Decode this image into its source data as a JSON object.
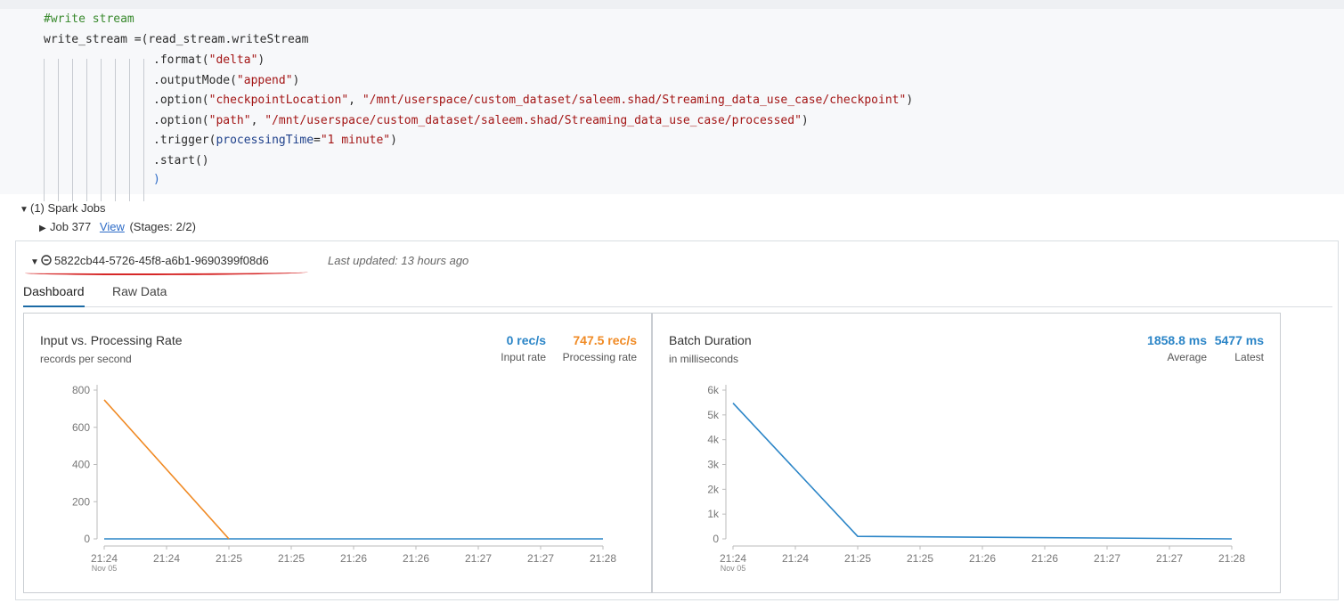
{
  "code": {
    "comment": "#write stream",
    "line1_var": "write_stream",
    "line1_op": " =",
    "line1_rest": "(read_stream.writeStream",
    "lines": [
      {
        "method": ".format(",
        "args": [
          {
            "t": "str",
            "v": "\"delta\""
          }
        ],
        "close": ")"
      },
      {
        "method": ".outputMode(",
        "args": [
          {
            "t": "str",
            "v": "\"append\""
          }
        ],
        "close": ")"
      },
      {
        "method": ".option(",
        "args": [
          {
            "t": "str",
            "v": "\"checkpointLocation\""
          },
          {
            "t": "plain",
            "v": ", "
          },
          {
            "t": "str",
            "v": "\"/mnt/userspace/custom_dataset/saleem.shad/Streaming_data_use_case/checkpoint\""
          }
        ],
        "close": ")"
      },
      {
        "method": ".option(",
        "args": [
          {
            "t": "str",
            "v": "\"path\""
          },
          {
            "t": "plain",
            "v": ", "
          },
          {
            "t": "str",
            "v": "\"/mnt/userspace/custom_dataset/saleem.shad/Streaming_data_use_case/processed\""
          }
        ],
        "close": ")"
      },
      {
        "method": ".trigger(",
        "args": [
          {
            "t": "kw",
            "v": "processingTime"
          },
          {
            "t": "plain",
            "v": "="
          },
          {
            "t": "str",
            "v": "\"1 minute\""
          }
        ],
        "close": ")"
      },
      {
        "method": ".start()",
        "args": [],
        "close": ""
      }
    ],
    "closing_paren": ")"
  },
  "jobs": {
    "summary": "(1) Spark Jobs",
    "job_label": "Job 377",
    "view_link": "View",
    "stages": "(Stages: 2/2)"
  },
  "stream": {
    "id": "5822cb44-5726-45f8-a6b1-9690399f08d6",
    "updated": "Last updated: 13 hours ago",
    "tabs": [
      "Dashboard",
      "Raw Data"
    ]
  },
  "colors": {
    "blue": "#2b85c7",
    "orange": "#f08a24",
    "active_tab": "#1b6aa5",
    "red_underline": "#d62828"
  },
  "rate_card": {
    "title": "Input vs. Processing Rate",
    "subtitle": "records per second",
    "input_value": "0 rec/s",
    "input_label": "Input rate",
    "processing_value": "747.5 rec/s",
    "processing_label": "Processing rate"
  },
  "batch_card": {
    "title": "Batch Duration",
    "subtitle": "in milliseconds",
    "average_value": "1858.8 ms",
    "average_label": "Average",
    "latest_value": "5477 ms",
    "latest_label": "Latest"
  },
  "chart_data": [
    {
      "type": "line",
      "title": "Input vs. Processing Rate",
      "ylabel": "records per second",
      "x": [
        "21:24",
        "21:24",
        "21:25",
        "21:25",
        "21:26",
        "21:26",
        "21:27",
        "21:27",
        "21:28"
      ],
      "x_sub": "Nov 05",
      "yticks": [
        "0",
        "200",
        "400",
        "600",
        "800"
      ],
      "ylim": [
        0,
        800
      ],
      "series": [
        {
          "name": "Input rate",
          "color": "#2b85c7",
          "values": [
            0,
            0,
            0,
            0,
            0,
            0,
            0,
            0,
            0
          ]
        },
        {
          "name": "Processing rate",
          "color": "#f08a24",
          "values": [
            747.5,
            null,
            0,
            null,
            null,
            null,
            null,
            null,
            null
          ]
        }
      ]
    },
    {
      "type": "line",
      "title": "Batch Duration",
      "ylabel": "in milliseconds",
      "x": [
        "21:24",
        "21:24",
        "21:25",
        "21:25",
        "21:26",
        "21:26",
        "21:27",
        "21:27",
        "21:28"
      ],
      "x_sub": "Nov 05",
      "yticks": [
        "0",
        "1k",
        "2k",
        "3k",
        "4k",
        "5k",
        "6k"
      ],
      "ylim": [
        0,
        6000
      ],
      "series": [
        {
          "color": "#2b85c7",
          "values": [
            5477,
            null,
            100,
            null,
            null,
            null,
            null,
            null,
            0
          ]
        }
      ]
    }
  ]
}
